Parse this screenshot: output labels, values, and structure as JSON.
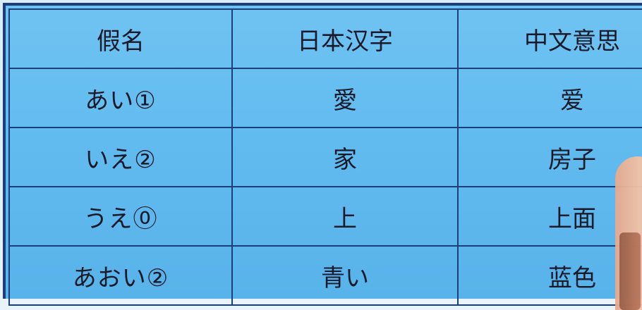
{
  "table": {
    "headers": [
      "假名",
      "日本汉字",
      "中文意思"
    ],
    "rows": [
      {
        "kana": "あい①",
        "kanji": "愛",
        "chinese": "爱"
      },
      {
        "kana": "いえ②",
        "kanji": "家",
        "chinese": "房子"
      },
      {
        "kana": "うえ⓪",
        "kanji": "上",
        "chinese": "上面"
      },
      {
        "kana": "あおい②",
        "kanji": "青い",
        "chinese": "蓝色"
      }
    ]
  }
}
